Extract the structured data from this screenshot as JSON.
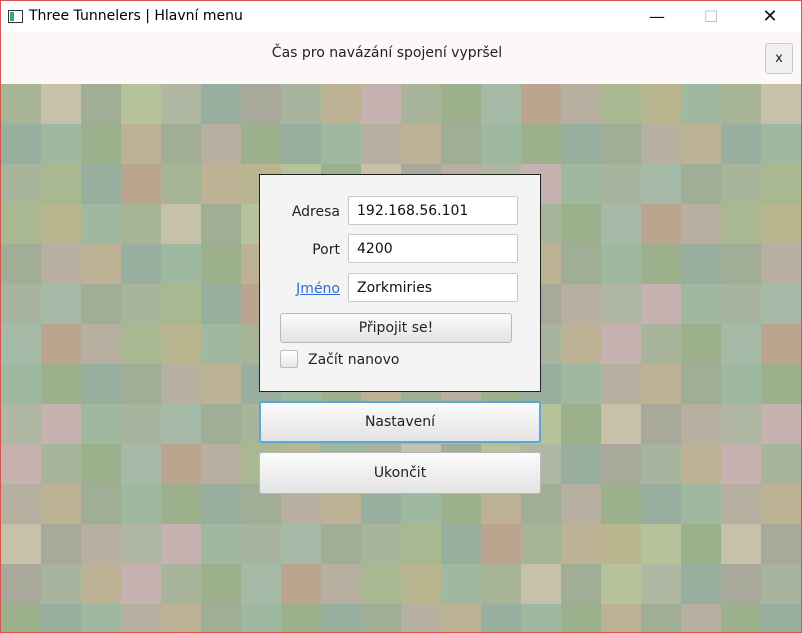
{
  "window": {
    "title": "Three Tunnelers | Hlavní menu",
    "controls": {
      "minimize": "—",
      "maximize": "☐",
      "close": "✕"
    }
  },
  "notice": {
    "text": "Čas pro navázání spojení vypršel",
    "close_label": "x"
  },
  "form": {
    "address_label": "Adresa",
    "address_value": "192.168.56.101",
    "port_label": "Port",
    "port_value": "4200",
    "name_label": "Jméno",
    "name_value": "Zorkmiries",
    "connect_label": "Připojit se!",
    "restart_label": "Začít nanovo",
    "restart_checked": false
  },
  "menu": {
    "settings_label": "Nastavení",
    "quit_label": "Ukončit"
  },
  "palette": [
    "#a7b496",
    "#9cb08c",
    "#b0b7a3",
    "#a8b891",
    "#bdb294",
    "#c7c1aa",
    "#a6bba7",
    "#98af9f",
    "#b9b68f",
    "#c6b3b1",
    "#9fae94",
    "#bba58f",
    "#a8a99a",
    "#9fb9a0",
    "#a9b59b",
    "#b5c29a",
    "#b7b0a0",
    "#a7b49e"
  ]
}
